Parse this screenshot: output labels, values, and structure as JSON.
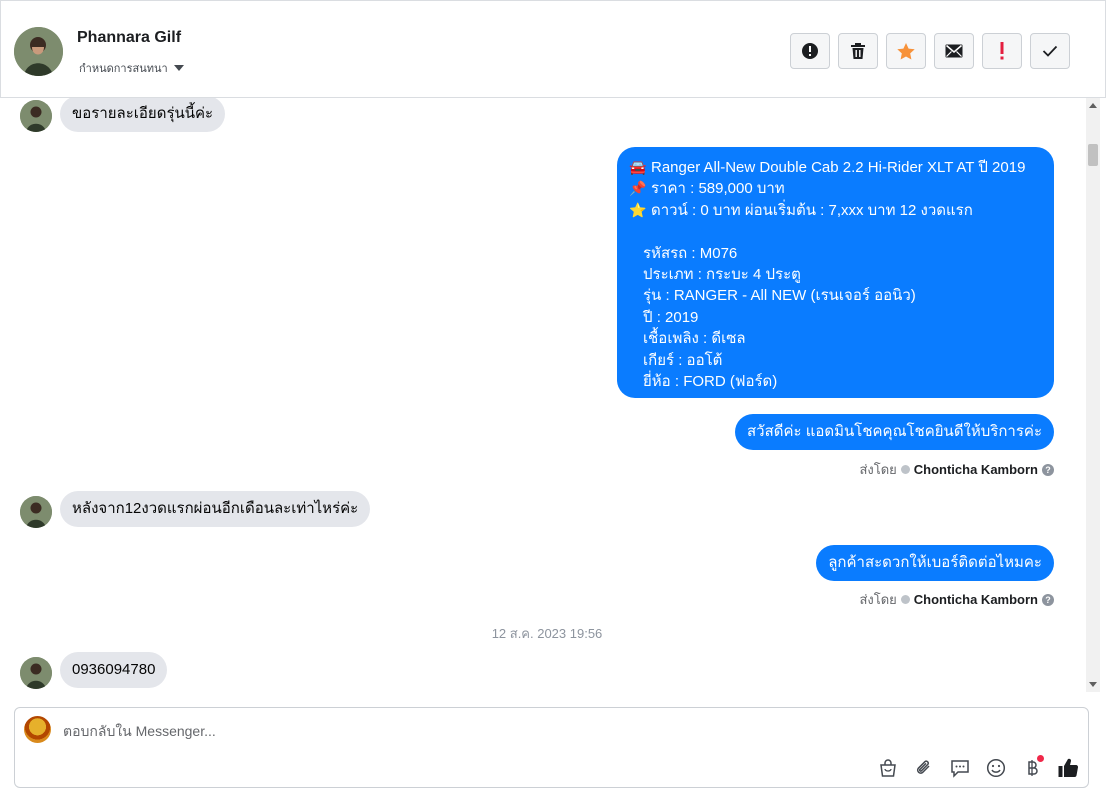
{
  "header": {
    "contact_name": "Phannara Gilf",
    "assign_label": "กำหนดการสนทนา",
    "toolbar": [
      {
        "name": "spam-button",
        "icon": "alert-circle-icon"
      },
      {
        "name": "delete-button",
        "icon": "trash-icon"
      },
      {
        "name": "star-button",
        "icon": "star-icon"
      },
      {
        "name": "mark-unread-button",
        "icon": "envelope-icon"
      },
      {
        "name": "follow-up-button",
        "icon": "exclamation-icon"
      },
      {
        "name": "done-button",
        "icon": "check-icon"
      }
    ]
  },
  "messages": {
    "m1": "ขอรายละเอียดรุ่นนี้ค่ะ",
    "car_info": {
      "line1_icon": "🚘",
      "line1": "Ranger All-New Double Cab 2.2 Hi-Rider XLT AT ปี 2019",
      "line2_icon": "📌",
      "line2": "ราคา : 589,000 บาท",
      "line3_icon": "⭐",
      "line3": "ดาวน์ : 0 บาท ผ่อนเริ่มต้น : 7,xxx บาท 12 งวดแรก",
      "details": [
        "รหัสรถ : M076",
        "ประเภท : กระบะ 4 ประตู",
        "รุ่น : RANGER - All NEW (เรนเจอร์ ออนิว)",
        "ปี : 2019",
        "เชื้อเพลิง : ดีเซล",
        "เกียร์ : ออโต้",
        "ยี่ห้อ : FORD (ฟอร์ด)"
      ]
    },
    "m3": "สวัสดีค่ะ แอดมินโชคคุณโชคยินดีให้บริการค่ะ",
    "sent_by_1": {
      "prefix": "ส่งโดย",
      "who": "Chonticha Kamborn"
    },
    "m4": "หลังจาก12งวดแรกผ่อนอีกเดือนละเท่าไหร่ค่ะ",
    "m5": "ลูกค้าสะดวกให้เบอร์ติดต่อไหมคะ",
    "sent_by_2": {
      "prefix": "ส่งโดย",
      "who": "Chonticha Kamborn"
    },
    "timestamp": "12 ส.ค. 2023 19:56",
    "m6": "0936094780"
  },
  "composer": {
    "placeholder": "ตอบกลับใน Messenger...",
    "tools": [
      "shopping-bag-icon",
      "paperclip-icon",
      "saved-reply-icon",
      "emoji-icon",
      "baht-icon",
      "thumbs-up-icon"
    ]
  },
  "colors": {
    "outgoing_bubble": "#0a7cff",
    "incoming_bubble": "#e4e6eb",
    "star": "#f7923a",
    "follow_up": "#e41e3f",
    "like": "#1c1e21"
  }
}
